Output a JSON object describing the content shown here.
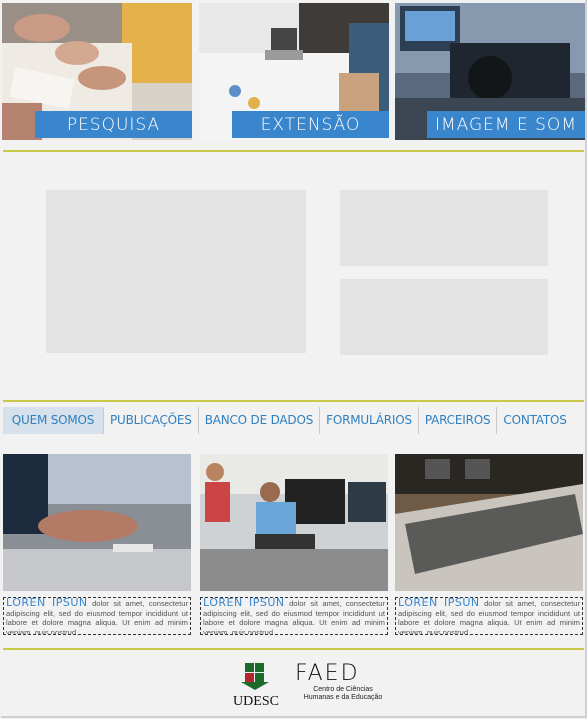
{
  "hero": [
    {
      "label": "PESQUISA"
    },
    {
      "label": "EXTENSÃO"
    },
    {
      "label": "IMAGEM E SOM"
    }
  ],
  "nav": {
    "items": [
      "QUEM SOMOS",
      "PUBLICAÇÕES",
      "BANCO DE DADOS",
      "FORMULÁRIOS",
      "PARCEIROS",
      "CONTATOS"
    ],
    "active_index": 0
  },
  "cards": [
    {
      "heading": "LOREN IPSUN",
      "body": "dolor sit amet, consectetur adipiscing elit, sed do eiusmod tempor incididunt ut labore et dolore magna aliqua. Ut enim ad minim veniam, quis nostrud"
    },
    {
      "heading": "LOREN IPSUN",
      "body": "dolor sit amet, consectetur adipiscing elit, sed do eiusmod tempor incididunt ut labore et dolore magna aliqua. Ut enim ad minim veniam, quis nostrud"
    },
    {
      "heading": "LOREN IPSUN",
      "body": "dolor sit amet, consectetur adipiscing elit, sed do eiusmod tempor incididunt ut labore et dolore magna aliqua. Ut enim ad minim veniam, quis nostrud"
    }
  ],
  "footer": {
    "udesc_label": "UDESC",
    "faed_logo_text": "FAED",
    "faed_line1": "Centro de Ciências",
    "faed_line2": "Humanas e da Educação"
  },
  "colors": {
    "accent_blue": "#3a86cc",
    "rule_olive": "#c9c948",
    "placeholder": "#e3e3e3"
  }
}
